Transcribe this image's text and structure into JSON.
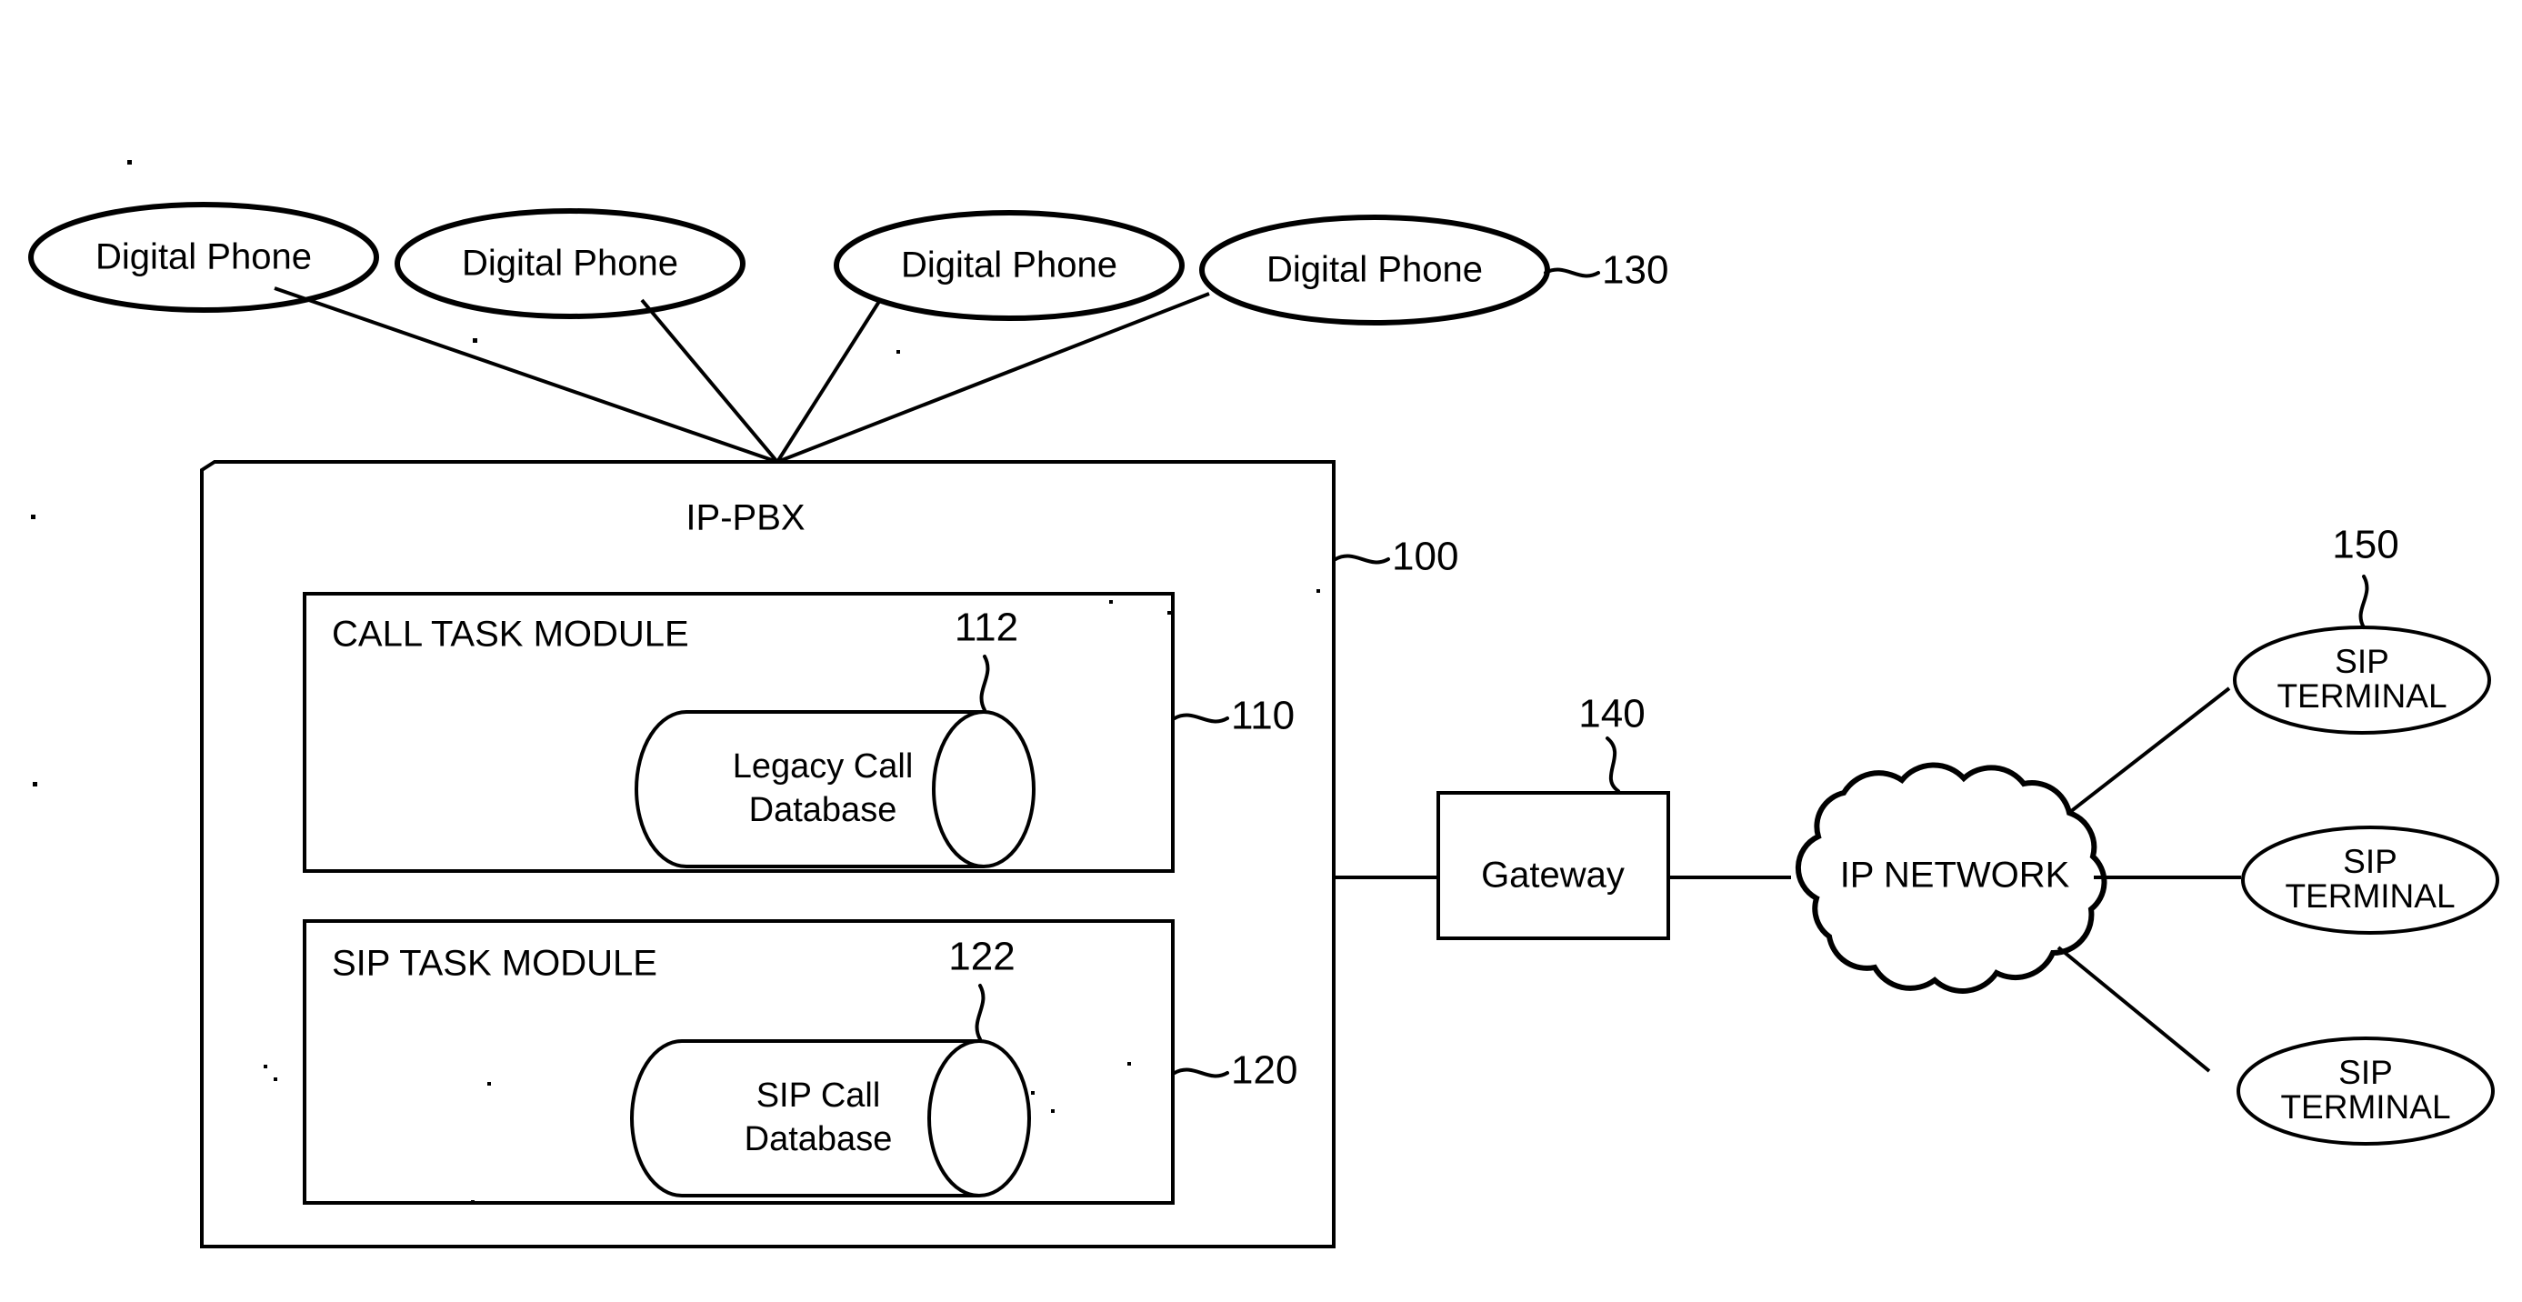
{
  "figure": {
    "type": "patent-block-diagram",
    "background_color": "#ffffff",
    "line_color": "#000000"
  },
  "phones": {
    "group_ref": "130",
    "items": [
      {
        "label": "Digital Phone"
      },
      {
        "label": "Digital Phone"
      },
      {
        "label": "Digital Phone"
      },
      {
        "label": "Digital Phone"
      }
    ]
  },
  "pbx": {
    "title": "IP-PBX",
    "ref": "100",
    "modules": [
      {
        "title": "CALL TASK MODULE",
        "ref": "110",
        "database": {
          "line1": "Legacy Call",
          "line2": "Database",
          "ref": "112"
        }
      },
      {
        "title": "SIP TASK MODULE",
        "ref": "120",
        "database": {
          "line1": "SIP Call",
          "line2": "Database",
          "ref": "122"
        }
      }
    ]
  },
  "gateway": {
    "label": "Gateway",
    "ref": "140"
  },
  "network": {
    "label": "IP NETWORK"
  },
  "terminals": {
    "group_ref": "150",
    "items": [
      {
        "line1": "SIP",
        "line2": "TERMINAL"
      },
      {
        "line1": "SIP",
        "line2": "TERMINAL"
      },
      {
        "line1": "SIP",
        "line2": "TERMINAL"
      }
    ]
  }
}
